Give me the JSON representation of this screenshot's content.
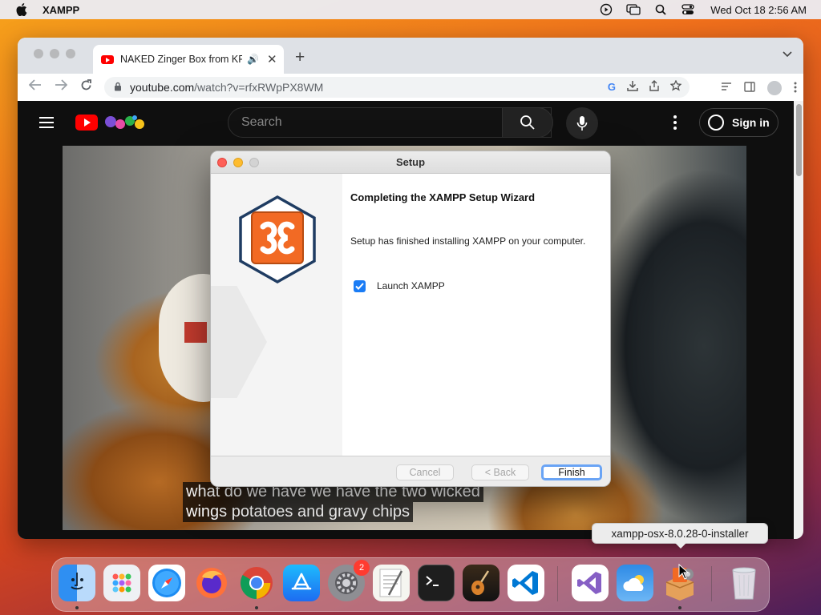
{
  "menubar": {
    "app_name": "XAMPP",
    "clock": "Wed Oct 18  2:56 AM",
    "status_icons": [
      "play-circle-icon",
      "screen-mirroring-icon",
      "search-icon",
      "control-center-icon"
    ]
  },
  "browser": {
    "tab_title": "NAKED Zinger Box from KFC",
    "url_host": "youtube.com",
    "url_path": "/watch?v=rfxRWpPX8WM",
    "new_tab": "+",
    "tab_close": "✕"
  },
  "youtube": {
    "search_placeholder": "Search",
    "sign_in_label": "Sign in",
    "caption_line1": "what do we have we have the two wicked",
    "caption_line2": "wings potatoes and gravy chips"
  },
  "dialog": {
    "title": "Setup",
    "heading": "Completing the XAMPP Setup Wizard",
    "body": "Setup has finished installing XAMPP on your computer.",
    "checkbox_label": "Launch XAMPP",
    "checkbox_checked": true,
    "cancel_label": "Cancel",
    "back_label": "< Back",
    "finish_label": "Finish"
  },
  "tooltip": {
    "text": "xampp-osx-8.0.28-0-installer"
  },
  "dock": {
    "items": [
      {
        "name": "finder",
        "icon": "finder-icon",
        "running": true
      },
      {
        "name": "launchpad",
        "icon": "launchpad-icon",
        "running": false
      },
      {
        "name": "safari",
        "icon": "safari-icon",
        "running": false
      },
      {
        "name": "firefox",
        "icon": "firefox-icon",
        "running": false
      },
      {
        "name": "chrome",
        "icon": "chrome-icon",
        "running": true
      },
      {
        "name": "app-store",
        "icon": "app-store-icon",
        "running": false
      },
      {
        "name": "system-settings",
        "icon": "gear-icon",
        "running": false,
        "badge": "2"
      },
      {
        "name": "textedit",
        "icon": "textedit-icon",
        "running": false
      },
      {
        "name": "terminal",
        "icon": "terminal-icon",
        "running": false
      },
      {
        "name": "garageband",
        "icon": "guitar-icon",
        "running": false
      },
      {
        "name": "vscode",
        "icon": "vscode-icon",
        "running": false
      },
      {
        "name": "visual-studio",
        "icon": "visual-studio-icon",
        "running": false
      },
      {
        "name": "weather",
        "icon": "weather-icon",
        "running": false
      },
      {
        "name": "xampp-installer",
        "icon": "installer-icon",
        "running": true
      },
      {
        "name": "trash",
        "icon": "trash-icon",
        "running": false
      }
    ]
  },
  "colors": {
    "youtube_red": "#ff0000",
    "xampp_orange": "#f26a24",
    "xampp_navy": "#1f3c62",
    "mac_blue": "#1a7cf5"
  }
}
